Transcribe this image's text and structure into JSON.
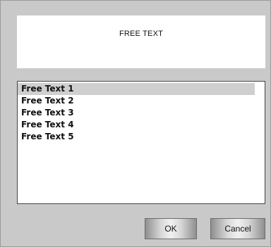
{
  "header": {
    "text": "FREE TEXT"
  },
  "list": {
    "items": [
      {
        "label": "Free Text 1",
        "selected": true
      },
      {
        "label": "Free Text 2",
        "selected": false
      },
      {
        "label": "Free Text 3",
        "selected": false
      },
      {
        "label": "Free Text 4",
        "selected": false
      },
      {
        "label": "Free Text 5",
        "selected": false
      }
    ]
  },
  "buttons": {
    "ok_label": "OK",
    "cancel_label": "Cancel"
  },
  "colors": {
    "dialog_bg": "#c9c9c9",
    "selection": "#cfcfcf"
  }
}
